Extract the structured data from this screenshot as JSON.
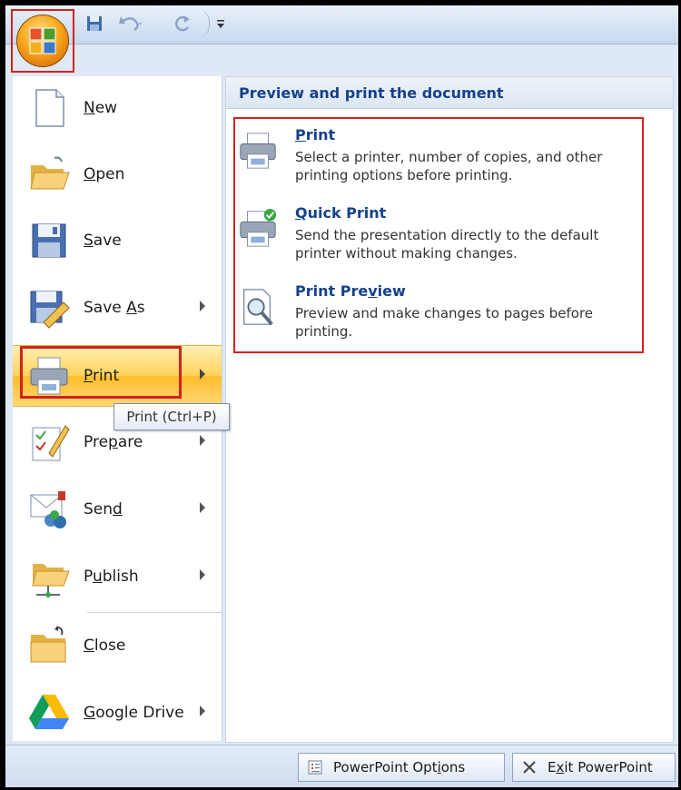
{
  "left_menu": {
    "items": [
      {
        "pre": "",
        "u": "N",
        "post": "ew",
        "icon": "new-document-icon"
      },
      {
        "pre": "",
        "u": "O",
        "post": "pen",
        "icon": "open-folder-icon"
      },
      {
        "pre": "",
        "u": "S",
        "post": "ave",
        "icon": "save-disk-icon"
      },
      {
        "pre": "Save ",
        "u": "A",
        "post": "s",
        "icon": "save-as-icon"
      },
      {
        "pre": "",
        "u": "P",
        "post": "rint",
        "icon": "printer-icon"
      },
      {
        "pre": "Pre",
        "u": "p",
        "post": "are",
        "icon": "prepare-icon"
      },
      {
        "pre": "Sen",
        "u": "d",
        "post": "",
        "icon": "send-icon"
      },
      {
        "pre": "P",
        "u": "u",
        "post": "blish",
        "icon": "publish-icon"
      },
      {
        "pre": "",
        "u": "C",
        "post": "lose",
        "icon": "close-folder-icon"
      },
      {
        "pre": "",
        "u": "G",
        "post": "oogle Drive",
        "icon": "google-drive-icon"
      }
    ]
  },
  "tooltip": "Print (Ctrl+P)",
  "right_panel": {
    "header": "Preview and print the document",
    "options": [
      {
        "pre": "",
        "u": "P",
        "post": "rint",
        "desc": "Select a printer, number of copies, and other printing options before printing.",
        "icon": "printer-icon"
      },
      {
        "pre": "",
        "u": "Q",
        "post": "uick Print",
        "desc": "Send the presentation directly to the default printer without making changes.",
        "icon": "quick-print-icon"
      },
      {
        "pre": "Print Pre",
        "u": "v",
        "post": "iew",
        "desc": "Preview and make changes to pages before printing.",
        "icon": "print-preview-icon"
      }
    ]
  },
  "bottom": {
    "options": {
      "pre": "PowerPoint Opt",
      "u": "i",
      "post": "ons"
    },
    "exit": {
      "pre": "E",
      "u": "x",
      "post": "it PowerPoint"
    }
  }
}
